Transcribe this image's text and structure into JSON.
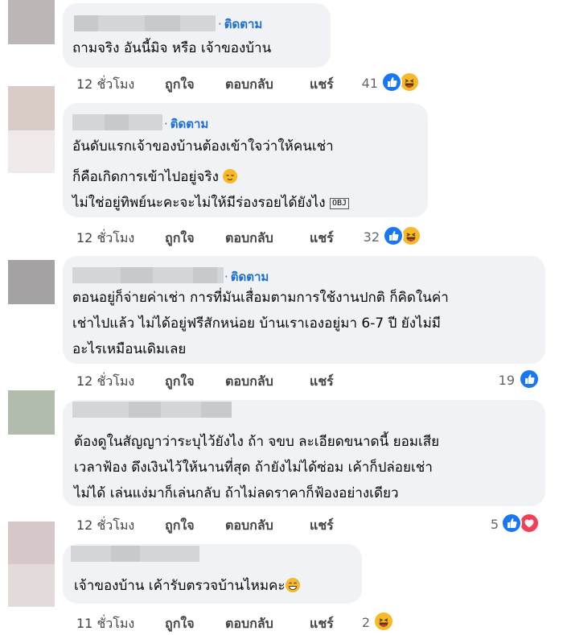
{
  "comments": [
    {
      "follow": "ติดตาม",
      "lines": [
        "ถามจริง อันนี้มิจ หรือ เจ้าของบ้าน"
      ],
      "time": "12 ชั่วโมง",
      "like": "ถูกใจ",
      "reply": "ตอบกลับ",
      "share": "แชร์",
      "reaction_count": "41",
      "reactions": [
        "like-icon",
        "haha-icon"
      ]
    },
    {
      "follow": "ติดตาม",
      "lines": [
        "อันดับแรกเจ้าของบ้านต้องเข้าใจว่าให้คนเช่า",
        "ก็คือเกิดการเข้าไปอยู่จริง",
        "ไม่ใช่อยู่ทิพย์นะคะจะไม่ให้มีร่องรอยได้ยังไง"
      ],
      "inline_badge": "OBJ",
      "time": "12 ชั่วโมง",
      "like": "ถูกใจ",
      "reply": "ตอบกลับ",
      "share": "แชร์",
      "reaction_count": "32",
      "reactions": [
        "like-icon",
        "haha-icon"
      ]
    },
    {
      "follow": "ติดตาม",
      "lines": [
        "ตอนอยู่ก็จ่ายค่าเช่า การที่มันเสื่อมตามการใช้งานปกติ ก็คิดในค่า",
        "เช่าไปแล้ว ไม่ได้อยู่ฟรีสักหน่อย บ้านเราเองอยู่มา 6-7 ปี ยังไม่มี",
        "อะไรเหมือนเดิมเลย"
      ],
      "time": "12 ชั่วโมง",
      "like": "ถูกใจ",
      "reply": "ตอบกลับ",
      "share": "แชร์",
      "reaction_count": "19",
      "reactions": [
        "like-icon"
      ]
    },
    {
      "lines": [
        "ต้องดูในสัญญาว่าระบุไว้ยังไง ถ้า จขบ ละเอียดขนาดนี้ ยอมเสีย",
        "เวลาฟ้อง ดึงเงินไว้ให้นานที่สุด ถ้ายังไม่ได้ซ่อม เค้าก็ปล่อยเช่า",
        "ไม่ได้ เล่นแง่มาก็เล่นกลับ ถ้าไม่ลดราคาก็ฟ้องอย่างเดียว"
      ],
      "time": "12 ชั่วโมง",
      "like": "ถูกใจ",
      "reply": "ตอบกลับ",
      "share": "แชร์",
      "reaction_count": "5",
      "reactions": [
        "like-icon",
        "love-icon"
      ]
    },
    {
      "lines": [
        "เจ้าของบ้าน เค้ารับตรวจบ้านไหมคะ"
      ],
      "time": "11 ชั่วโมง",
      "like": "ถูกใจ",
      "reply": "ตอบกลับ",
      "share": "แชร์",
      "reaction_count": "2",
      "reactions": [
        "haha-icon"
      ]
    }
  ],
  "colors": {
    "bubble": "#f0f2f5",
    "follow": "#1b6fd6",
    "like": "#1877f2",
    "haha": "#f7b928",
    "love": "#f33e58"
  }
}
